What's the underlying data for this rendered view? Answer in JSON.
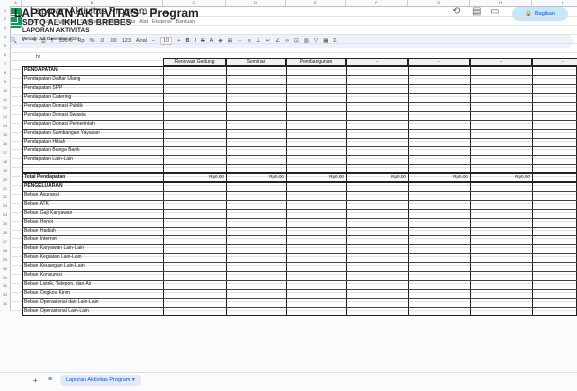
{
  "app": {
    "doc_title": "Laporan Aktivitas Program",
    "menus": [
      "File",
      "Edit",
      "Tampilan",
      "Sisipkan",
      "Format",
      "Data",
      "Alat",
      "Ekstensi",
      "Bantuan"
    ],
    "share_label": "Bagikan",
    "colors": {
      "accent": "#0b57d0",
      "logo": "#0f9d58",
      "share_bg": "#c2e7ff"
    }
  },
  "toolbar": {
    "zoom": "100%",
    "currency": "Rp",
    "percent": "%",
    "dec_less": ".0",
    "dec_more": ".00",
    "fmt_123": "123",
    "font": "Arial",
    "font_size": "10",
    "minus": "−",
    "plus": "+",
    "bold": "B",
    "italic": "I",
    "strike": "S",
    "text_color": "A"
  },
  "formula_bar": {
    "cell_ref": "A1",
    "fx": "fx",
    "value": ""
  },
  "grid": {
    "columns": [
      "A",
      "B",
      "C",
      "D",
      "E",
      "F",
      "G",
      "H",
      "I"
    ],
    "rows": [
      "1",
      "2",
      "3",
      "4",
      "5",
      "6",
      "7",
      "8",
      "9",
      "10",
      "11",
      "12",
      "13",
      "14",
      "15",
      "16",
      "17",
      "18",
      "19",
      "20",
      "21",
      "22",
      "23",
      "24",
      "25",
      "26",
      "27",
      "28",
      "29",
      "30",
      "31",
      "32",
      "33",
      "34"
    ],
    "title": "LAPORAN AKTIVITAS - Program",
    "org": "SDTQ AL-IKHLAS BREBES",
    "subtitle": "LAPORAN AKTIVITAS",
    "period": "Periode Juli-Desember 2024",
    "table_headers": [
      "Renovasi Gedung",
      "Seminar",
      "Pembangunan",
      "-",
      "-",
      "-",
      "-"
    ],
    "income_header": "PENDAPATAN",
    "income_items": [
      "Pendapatan Daftar Ulang",
      "Pendapatan SPP",
      "Pendapatan Catering",
      "Pendapatan Donasi Publik",
      "Pendapatan Donasi Swasta",
      "Pendapatan Donasi Pemerintah",
      "Pendapatan Sumbangan Yayasan",
      "Pendapatan Hibah",
      "Pendapatan Bunga Bank",
      "Pendapatan Lain-Lain"
    ],
    "total_income_label": "Total Pendapatan",
    "total_income_values": [
      "Rp0,00",
      "Rp0,00",
      "Rp0,00",
      "Rp0,00",
      "Rp0,00",
      "Rp0,00",
      "Rp"
    ],
    "expense_header": "PENGELUARAN",
    "expense_items": [
      "Beban Asuransi",
      "Beban ATK",
      "Beban Gaji Karyawan",
      "Beban Honor",
      "Beban Hadiah",
      "Beban Internet",
      "Beban Karyawan Lain-Lain",
      "Beban Kegiatan Lain-Lain",
      "Beban Keuangan Lain-Lain",
      "Beban Konsumsi",
      "Beban Listrik, Telepon, dan Air",
      "Beban Ongkos Kirim",
      "Beban Operasional dan Lain-Lain",
      "Beban Operasional Lain-Lain"
    ]
  },
  "sheets": {
    "add": "+",
    "all": "≡",
    "active": "Laporan Aktivitas Program",
    "caret": "▾"
  }
}
